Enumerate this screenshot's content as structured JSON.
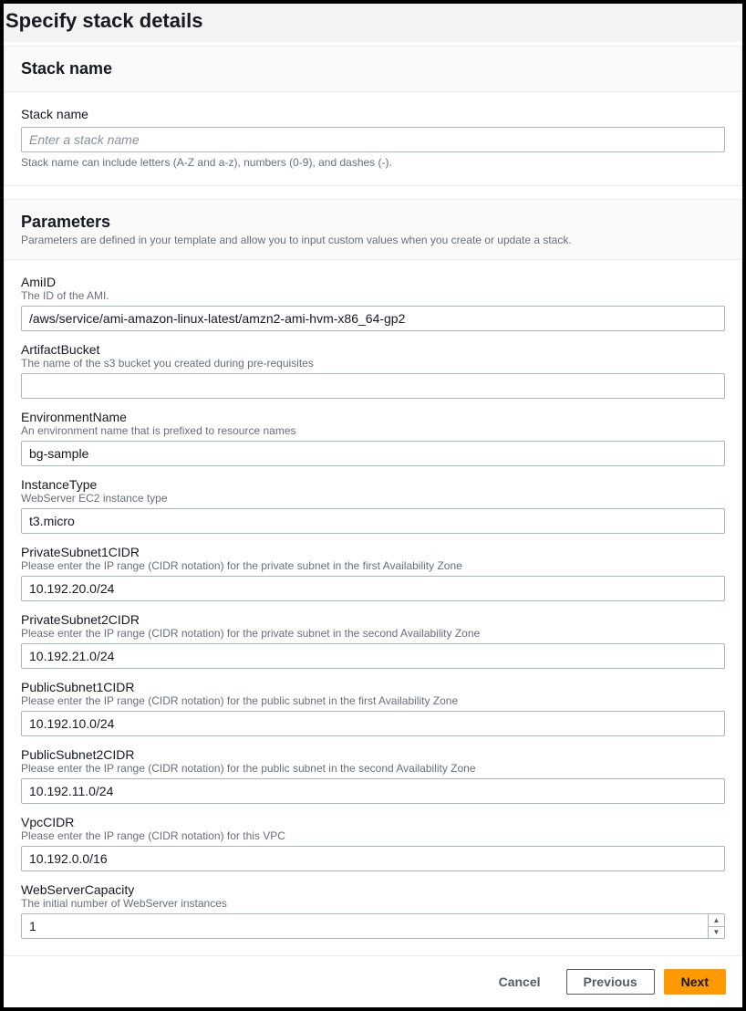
{
  "page": {
    "title": "Specify stack details"
  },
  "stackName": {
    "sectionTitle": "Stack name",
    "label": "Stack name",
    "placeholder": "Enter a stack name",
    "value": "",
    "hint": "Stack name can include letters (A-Z and a-z), numbers (0-9), and dashes (-)."
  },
  "parameters": {
    "sectionTitle": "Parameters",
    "sectionDesc": "Parameters are defined in your template and allow you to input custom values when you create or update a stack.",
    "items": [
      {
        "name": "AmiID",
        "hint": "The ID of the AMI.",
        "value": "/aws/service/ami-amazon-linux-latest/amzn2-ami-hvm-x86_64-gp2",
        "type": "text"
      },
      {
        "name": "ArtifactBucket",
        "hint": "The name of the s3 bucket you created during pre-requisites",
        "value": "",
        "type": "text"
      },
      {
        "name": "EnvironmentName",
        "hint": "An environment name that is prefixed to resource names",
        "value": "bg-sample",
        "type": "text"
      },
      {
        "name": "InstanceType",
        "hint": "WebServer EC2 instance type",
        "value": "t3.micro",
        "type": "text"
      },
      {
        "name": "PrivateSubnet1CIDR",
        "hint": "Please enter the IP range (CIDR notation) for the private subnet in the first Availability Zone",
        "value": "10.192.20.0/24",
        "type": "text"
      },
      {
        "name": "PrivateSubnet2CIDR",
        "hint": "Please enter the IP range (CIDR notation) for the private subnet in the second Availability Zone",
        "value": "10.192.21.0/24",
        "type": "text"
      },
      {
        "name": "PublicSubnet1CIDR",
        "hint": "Please enter the IP range (CIDR notation) for the public subnet in the first Availability Zone",
        "value": "10.192.10.0/24",
        "type": "text"
      },
      {
        "name": "PublicSubnet2CIDR",
        "hint": "Please enter the IP range (CIDR notation) for the public subnet in the second Availability Zone",
        "value": "10.192.11.0/24",
        "type": "text"
      },
      {
        "name": "VpcCIDR",
        "hint": "Please enter the IP range (CIDR notation) for this VPC",
        "value": "10.192.0.0/16",
        "type": "text"
      },
      {
        "name": "WebServerCapacity",
        "hint": "The initial number of WebServer instances",
        "value": "1",
        "type": "number"
      }
    ]
  },
  "footer": {
    "cancel": "Cancel",
    "previous": "Previous",
    "next": "Next"
  }
}
